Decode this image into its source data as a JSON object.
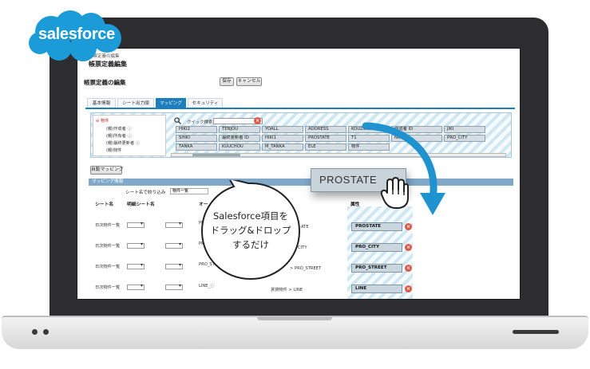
{
  "brand": {
    "logo_text": "salesforce",
    "logo_color": "#1b9bd7"
  },
  "screen": {
    "title_small": "帳票定義の編集",
    "title_big": "帳票定義編集",
    "section_title": "帳票定義の編集",
    "save_label": "保存",
    "cancel_label": "キャンセル",
    "tabs": [
      {
        "label": "基本情報"
      },
      {
        "label": "シート出力順"
      },
      {
        "label": "マッピング"
      },
      {
        "label": "セキュリティ"
      }
    ],
    "tree": {
      "root": "⊖ 物件",
      "items": [
        "(親)作成者 ⓘ",
        "(親)所有者 ⓘ",
        "(親)最終更新者 ⓘ",
        "(親)物件"
      ]
    },
    "quick_search_label": "クイック検索",
    "fields_row1": [
      "HIKI2",
      "TENJOU",
      "YOALL",
      "ADDRESS",
      "KOUZOU",
      "作成者 ID",
      "JIKI"
    ],
    "fields_row2": [
      "SHIKI",
      "最終更新者 ID",
      "HIKI1",
      "PROSTATE",
      "T1",
      "NOTA",
      "PRO_CITY"
    ],
    "fields_row3": [
      "TANKA",
      "KUUCHOU",
      "M_TANKA",
      "ELE",
      "物件"
    ],
    "auto_mapping_label": "自動マッピング",
    "mapping_header": "マッピング情報",
    "sheet_label": "シート名で絞り込み",
    "sheet_value": "物件一覧",
    "col_headers": {
      "sheet": "シート名",
      "detail": "明細シート名",
      "output": "オー",
      "attr": "属性"
    },
    "rows": [
      {
        "sheet": "日次物件一覧",
        "output": "PRO",
        "path": "ATE",
        "attr": "PROSTATE"
      },
      {
        "sheet": "日次物件一覧",
        "output": "PRO",
        "path": "CITY",
        "attr": "PRO_CITY"
      },
      {
        "sheet": "日次物件一覧",
        "output": "PRO_STREE",
        "path": "> PRO_STREET",
        "attr": "PRO_STREET"
      },
      {
        "sheet": "日次物件一覧",
        "output": "LINE_ⓘ",
        "path": "賃貸物件 > LINE",
        "attr": "LINE"
      }
    ]
  },
  "overlay": {
    "drag_chip_label": "PROSTATE",
    "bubble_line1": "Salesforce項目を",
    "bubble_line2": "ドラッグ&ドロップ",
    "bubble_line3": "するだけ",
    "arrow_color": "#1f93cf"
  }
}
